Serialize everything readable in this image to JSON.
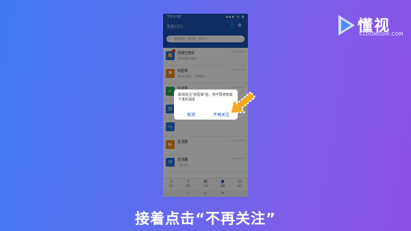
{
  "brand": {
    "name": "懂视",
    "domain": "51DONGSHI.COM"
  },
  "status": {
    "time": "下午2:50",
    "icons": "▪▪▪ ◔ ▮"
  },
  "header": {
    "title": "消息(37)",
    "search_placeholder": "搜索服务、通讯录、联系人..."
  },
  "messages": [
    {
      "title": "快递已签收",
      "subtitle": "您的包裹已签收...",
      "time": "2021-03-01",
      "color": "#2a6fd6",
      "icon": "bell-icon",
      "badge": true
    },
    {
      "title": "好医保",
      "subtitle": "关注好医保，了解更多...",
      "time": "2021-02-28",
      "color": "#f08a24",
      "icon": "heart-icon",
      "badge": false
    },
    {
      "title": "生活号",
      "subtitle": "...",
      "time": "2021-02-27",
      "color": "#27a35c",
      "icon": "leaf-icon",
      "badge": false
    },
    {
      "title": "",
      "subtitle": "",
      "time": "",
      "color": "#2a6fd6",
      "icon": "doc-icon",
      "badge": false
    },
    {
      "title": "",
      "subtitle": "",
      "time": "",
      "color": "#2a6fd6",
      "icon": "card-icon",
      "badge": false
    },
    {
      "title": "生活圈",
      "subtitle": "",
      "time": "2021-02-20",
      "color": "#f08a24",
      "icon": "play-icon",
      "badge": false
    },
    {
      "title": "生活圈",
      "subtitle": "只是关注...",
      "time": "2021-02-19",
      "color": "#2a6fd6",
      "icon": "chat-icon",
      "badge": false
    }
  ],
  "tabs": [
    {
      "label": "首页",
      "icon": "home-icon"
    },
    {
      "label": "理财",
      "icon": "money-icon"
    },
    {
      "label": "口碑",
      "icon": "shop-icon"
    },
    {
      "label": "消息",
      "icon": "message-icon",
      "active": true
    },
    {
      "label": "我的",
      "icon": "user-icon"
    }
  ],
  "dialog": {
    "message": "取消关注\"好医保\"后，将不再收到其下发的消息",
    "cancel": "取消",
    "confirm": "不再关注"
  },
  "caption": "接着点击“不再关注”"
}
